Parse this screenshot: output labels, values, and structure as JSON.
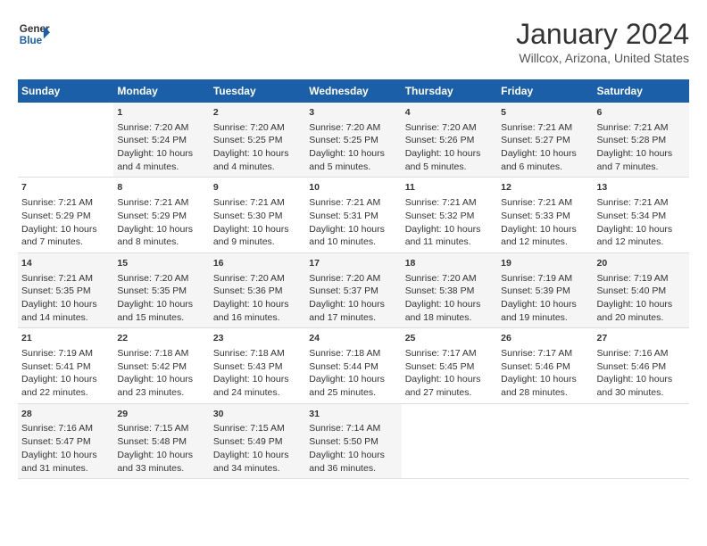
{
  "logo": {
    "line1": "General",
    "line2": "Blue"
  },
  "title": "January 2024",
  "subtitle": "Willcox, Arizona, United States",
  "colors": {
    "header_bg": "#1a5fa8",
    "header_text": "#ffffff",
    "odd_row": "#f5f5f5",
    "even_row": "#ffffff"
  },
  "days_of_week": [
    "Sunday",
    "Monday",
    "Tuesday",
    "Wednesday",
    "Thursday",
    "Friday",
    "Saturday"
  ],
  "weeks": [
    [
      {
        "day": "",
        "content": ""
      },
      {
        "day": "1",
        "content": "Sunrise: 7:20 AM\nSunset: 5:24 PM\nDaylight: 10 hours\nand 4 minutes."
      },
      {
        "day": "2",
        "content": "Sunrise: 7:20 AM\nSunset: 5:25 PM\nDaylight: 10 hours\nand 4 minutes."
      },
      {
        "day": "3",
        "content": "Sunrise: 7:20 AM\nSunset: 5:25 PM\nDaylight: 10 hours\nand 5 minutes."
      },
      {
        "day": "4",
        "content": "Sunrise: 7:20 AM\nSunset: 5:26 PM\nDaylight: 10 hours\nand 5 minutes."
      },
      {
        "day": "5",
        "content": "Sunrise: 7:21 AM\nSunset: 5:27 PM\nDaylight: 10 hours\nand 6 minutes."
      },
      {
        "day": "6",
        "content": "Sunrise: 7:21 AM\nSunset: 5:28 PM\nDaylight: 10 hours\nand 7 minutes."
      }
    ],
    [
      {
        "day": "7",
        "content": "Sunrise: 7:21 AM\nSunset: 5:29 PM\nDaylight: 10 hours\nand 7 minutes."
      },
      {
        "day": "8",
        "content": "Sunrise: 7:21 AM\nSunset: 5:29 PM\nDaylight: 10 hours\nand 8 minutes."
      },
      {
        "day": "9",
        "content": "Sunrise: 7:21 AM\nSunset: 5:30 PM\nDaylight: 10 hours\nand 9 minutes."
      },
      {
        "day": "10",
        "content": "Sunrise: 7:21 AM\nSunset: 5:31 PM\nDaylight: 10 hours\nand 10 minutes."
      },
      {
        "day": "11",
        "content": "Sunrise: 7:21 AM\nSunset: 5:32 PM\nDaylight: 10 hours\nand 11 minutes."
      },
      {
        "day": "12",
        "content": "Sunrise: 7:21 AM\nSunset: 5:33 PM\nDaylight: 10 hours\nand 12 minutes."
      },
      {
        "day": "13",
        "content": "Sunrise: 7:21 AM\nSunset: 5:34 PM\nDaylight: 10 hours\nand 12 minutes."
      }
    ],
    [
      {
        "day": "14",
        "content": "Sunrise: 7:21 AM\nSunset: 5:35 PM\nDaylight: 10 hours\nand 14 minutes."
      },
      {
        "day": "15",
        "content": "Sunrise: 7:20 AM\nSunset: 5:35 PM\nDaylight: 10 hours\nand 15 minutes."
      },
      {
        "day": "16",
        "content": "Sunrise: 7:20 AM\nSunset: 5:36 PM\nDaylight: 10 hours\nand 16 minutes."
      },
      {
        "day": "17",
        "content": "Sunrise: 7:20 AM\nSunset: 5:37 PM\nDaylight: 10 hours\nand 17 minutes."
      },
      {
        "day": "18",
        "content": "Sunrise: 7:20 AM\nSunset: 5:38 PM\nDaylight: 10 hours\nand 18 minutes."
      },
      {
        "day": "19",
        "content": "Sunrise: 7:19 AM\nSunset: 5:39 PM\nDaylight: 10 hours\nand 19 minutes."
      },
      {
        "day": "20",
        "content": "Sunrise: 7:19 AM\nSunset: 5:40 PM\nDaylight: 10 hours\nand 20 minutes."
      }
    ],
    [
      {
        "day": "21",
        "content": "Sunrise: 7:19 AM\nSunset: 5:41 PM\nDaylight: 10 hours\nand 22 minutes."
      },
      {
        "day": "22",
        "content": "Sunrise: 7:18 AM\nSunset: 5:42 PM\nDaylight: 10 hours\nand 23 minutes."
      },
      {
        "day": "23",
        "content": "Sunrise: 7:18 AM\nSunset: 5:43 PM\nDaylight: 10 hours\nand 24 minutes."
      },
      {
        "day": "24",
        "content": "Sunrise: 7:18 AM\nSunset: 5:44 PM\nDaylight: 10 hours\nand 25 minutes."
      },
      {
        "day": "25",
        "content": "Sunrise: 7:17 AM\nSunset: 5:45 PM\nDaylight: 10 hours\nand 27 minutes."
      },
      {
        "day": "26",
        "content": "Sunrise: 7:17 AM\nSunset: 5:46 PM\nDaylight: 10 hours\nand 28 minutes."
      },
      {
        "day": "27",
        "content": "Sunrise: 7:16 AM\nSunset: 5:46 PM\nDaylight: 10 hours\nand 30 minutes."
      }
    ],
    [
      {
        "day": "28",
        "content": "Sunrise: 7:16 AM\nSunset: 5:47 PM\nDaylight: 10 hours\nand 31 minutes."
      },
      {
        "day": "29",
        "content": "Sunrise: 7:15 AM\nSunset: 5:48 PM\nDaylight: 10 hours\nand 33 minutes."
      },
      {
        "day": "30",
        "content": "Sunrise: 7:15 AM\nSunset: 5:49 PM\nDaylight: 10 hours\nand 34 minutes."
      },
      {
        "day": "31",
        "content": "Sunrise: 7:14 AM\nSunset: 5:50 PM\nDaylight: 10 hours\nand 36 minutes."
      },
      {
        "day": "",
        "content": ""
      },
      {
        "day": "",
        "content": ""
      },
      {
        "day": "",
        "content": ""
      }
    ]
  ]
}
